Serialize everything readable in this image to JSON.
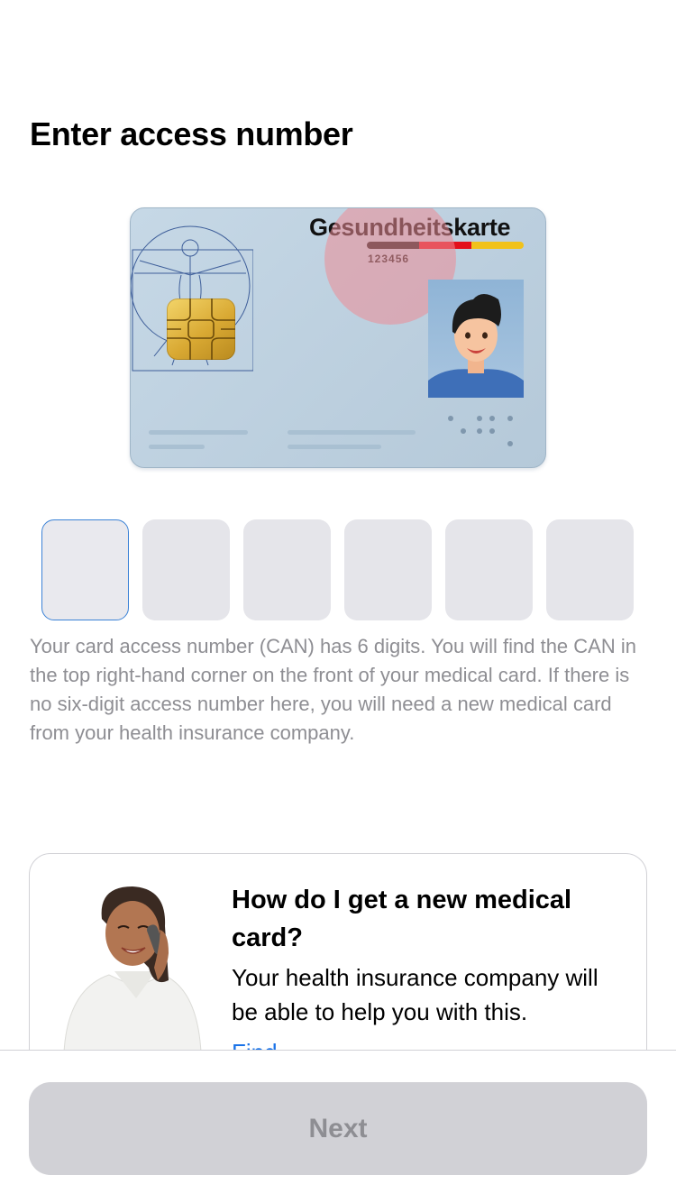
{
  "page": {
    "title": "Enter access number"
  },
  "card_illustration": {
    "brand": "Gesundheitskarte",
    "can_number": "123456",
    "flag_colors": [
      "#1a1a1a",
      "#e3101c",
      "#f1c21b"
    ],
    "highlight_color": "#ec8c96"
  },
  "can_input": {
    "digit_count": 6,
    "values": [
      "",
      "",
      "",
      "",
      "",
      ""
    ],
    "active_index": 0
  },
  "help_text": "Your card access number (CAN) has 6 digits. You will find the CAN in the top right-hand corner on the front of your medical card. If there is no six-digit access number here, you will need a new medical card from your health insurance company.",
  "info_card": {
    "title": "How do I get a new medical card?",
    "body": "Your health insurance company will be able to help you with this.",
    "link": "Find",
    "icon": "person-on-phone-illustration"
  },
  "footer": {
    "next_label": "Next",
    "next_enabled": false
  },
  "colors": {
    "accent": "#3b82d6",
    "link": "#1a73e8",
    "box_fill": "#e5e5ea",
    "secondary_text": "#8e8e93"
  }
}
